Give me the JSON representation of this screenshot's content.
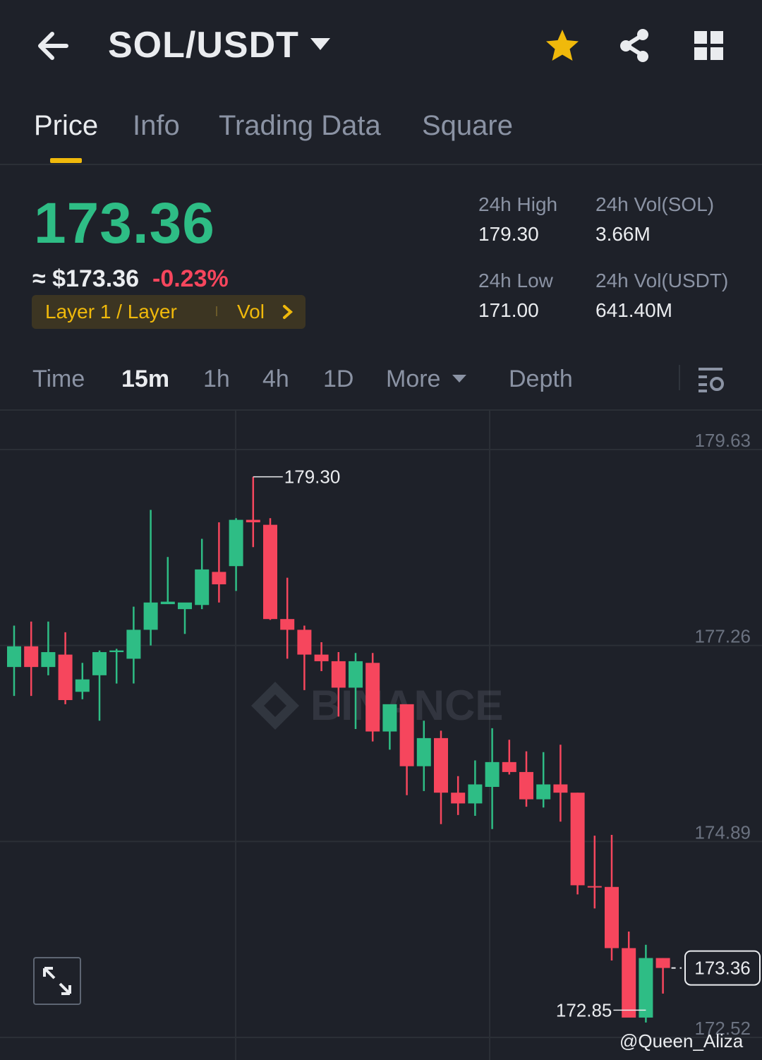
{
  "header": {
    "pair": "SOL/USDT",
    "icons": [
      "back-arrow-icon",
      "caret-down-icon",
      "star-icon",
      "share-icon",
      "grid-icon"
    ],
    "star_color": "#f0b90b"
  },
  "tabs": [
    {
      "label": "Price",
      "active": true
    },
    {
      "label": "Info",
      "active": false
    },
    {
      "label": "Trading Data",
      "active": false
    },
    {
      "label": "Square",
      "active": false
    }
  ],
  "price": {
    "last": "173.36",
    "usd": "≈ $173.36",
    "change": "-0.23%",
    "tag": "Layer 1 / Layer",
    "vol": "Vol",
    "up_color": "#2ebd85",
    "down_color": "#f6465d"
  },
  "stats": {
    "high_label": "24h High",
    "high": "179.30",
    "low_label": "24h Low",
    "low": "171.00",
    "vol_sol_label": "24h Vol(SOL)",
    "vol_sol": "3.66M",
    "vol_usdt_label": "24h Vol(USDT)",
    "vol_usdt": "641.40M"
  },
  "intervals": {
    "items": [
      "Time",
      "15m",
      "1h",
      "4h",
      "1D",
      "More",
      "Depth"
    ],
    "active": "15m"
  },
  "chart_data": {
    "type": "candlestick",
    "y_ticks": [
      179.63,
      177.26,
      174.89,
      172.52
    ],
    "high_marker": "179.30",
    "low_marker": "172.85",
    "last_price_label": "173.36",
    "watermark": "BINANCE",
    "candles": [
      {
        "o": 177.0,
        "h": 177.5,
        "l": 176.65,
        "c": 177.25
      },
      {
        "o": 177.25,
        "h": 177.55,
        "l": 176.65,
        "c": 177.0
      },
      {
        "o": 177.0,
        "h": 177.55,
        "l": 176.9,
        "c": 177.18
      },
      {
        "o": 177.15,
        "h": 177.42,
        "l": 176.55,
        "c": 176.6
      },
      {
        "o": 176.7,
        "h": 177.05,
        "l": 176.61,
        "c": 176.85
      },
      {
        "o": 176.9,
        "h": 177.2,
        "l": 176.35,
        "c": 177.18
      },
      {
        "o": 177.18,
        "h": 177.22,
        "l": 176.8,
        "c": 177.2
      },
      {
        "o": 177.1,
        "h": 177.73,
        "l": 176.8,
        "c": 177.45
      },
      {
        "o": 177.45,
        "h": 178.9,
        "l": 177.26,
        "c": 177.78
      },
      {
        "o": 177.76,
        "h": 178.33,
        "l": 177.78,
        "c": 177.79
      },
      {
        "o": 177.7,
        "h": 177.75,
        "l": 177.4,
        "c": 177.78
      },
      {
        "o": 177.75,
        "h": 178.55,
        "l": 177.7,
        "c": 178.18
      },
      {
        "o": 178.15,
        "h": 178.75,
        "l": 177.78,
        "c": 178.0
      },
      {
        "o": 178.22,
        "h": 178.8,
        "l": 177.92,
        "c": 178.78
      },
      {
        "o": 178.78,
        "h": 179.3,
        "l": 178.45,
        "c": 178.75
      },
      {
        "o": 178.72,
        "h": 178.8,
        "l": 177.57,
        "c": 177.58
      },
      {
        "o": 177.58,
        "h": 178.08,
        "l": 177.1,
        "c": 177.45
      },
      {
        "o": 177.45,
        "h": 177.5,
        "l": 176.72,
        "c": 177.15
      },
      {
        "o": 177.15,
        "h": 177.3,
        "l": 176.95,
        "c": 177.07
      },
      {
        "o": 177.07,
        "h": 177.18,
        "l": 176.4,
        "c": 176.75
      },
      {
        "o": 176.75,
        "h": 177.17,
        "l": 176.25,
        "c": 177.07
      },
      {
        "o": 177.05,
        "h": 177.17,
        "l": 176.1,
        "c": 176.22
      },
      {
        "o": 176.22,
        "h": 176.4,
        "l": 176.0,
        "c": 176.55
      },
      {
        "o": 176.55,
        "h": 176.48,
        "l": 175.45,
        "c": 175.8
      },
      {
        "o": 175.8,
        "h": 176.35,
        "l": 175.5,
        "c": 176.14
      },
      {
        "o": 176.14,
        "h": 176.23,
        "l": 175.1,
        "c": 175.48
      },
      {
        "o": 175.48,
        "h": 175.68,
        "l": 175.21,
        "c": 175.35
      },
      {
        "o": 175.35,
        "h": 175.87,
        "l": 175.2,
        "c": 175.58
      },
      {
        "o": 175.55,
        "h": 176.26,
        "l": 175.04,
        "c": 175.85
      },
      {
        "o": 175.85,
        "h": 176.12,
        "l": 175.7,
        "c": 175.73
      },
      {
        "o": 175.73,
        "h": 175.98,
        "l": 175.31,
        "c": 175.4
      },
      {
        "o": 175.4,
        "h": 175.97,
        "l": 175.3,
        "c": 175.58
      },
      {
        "o": 175.58,
        "h": 176.06,
        "l": 175.13,
        "c": 175.48
      },
      {
        "o": 175.48,
        "h": 175.48,
        "l": 174.25,
        "c": 174.36
      },
      {
        "o": 174.35,
        "h": 174.96,
        "l": 174.08,
        "c": 174.34
      },
      {
        "o": 174.34,
        "h": 174.97,
        "l": 173.45,
        "c": 173.6
      },
      {
        "o": 173.6,
        "h": 173.8,
        "l": 172.85,
        "c": 172.76
      },
      {
        "o": 172.76,
        "h": 173.64,
        "l": 172.7,
        "c": 173.48
      },
      {
        "o": 173.48,
        "h": 173.48,
        "l": 173.05,
        "c": 173.36
      }
    ]
  }
}
